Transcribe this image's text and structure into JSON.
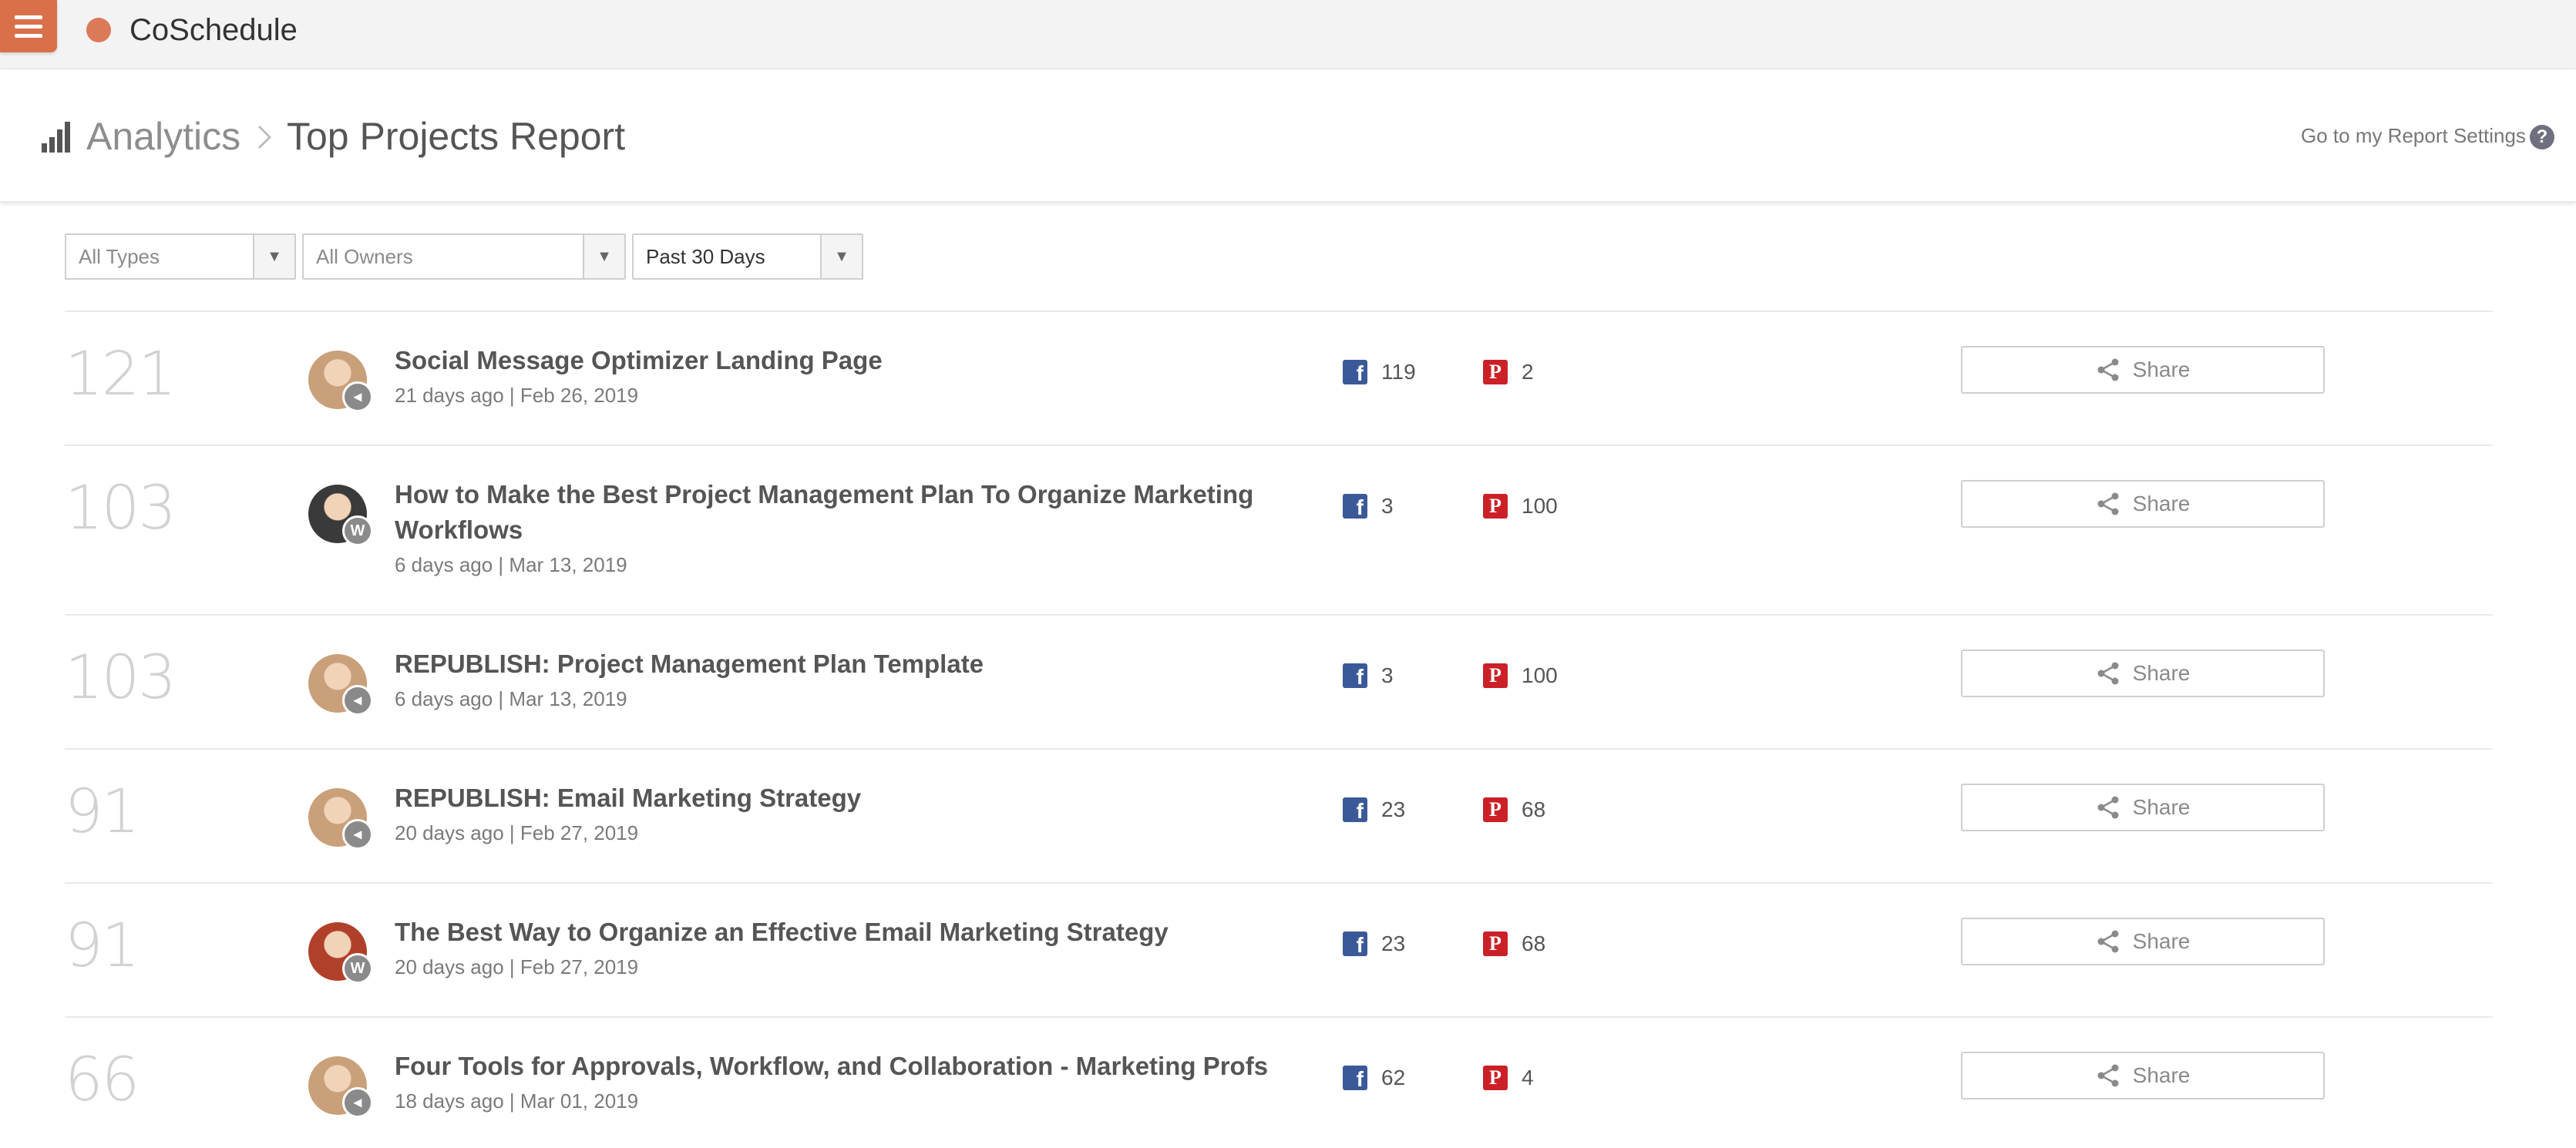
{
  "app": {
    "name": "CoSchedule",
    "accent": "#d9704a"
  },
  "header": {
    "breadcrumb_root": "Analytics",
    "page_title": "Top Projects Report",
    "settings_link": "Go to my Report Settings",
    "help_label": "?"
  },
  "filters": {
    "types": "All Types",
    "owners": "All Owners",
    "period": "Past 30 Days"
  },
  "share_label": "Share",
  "rows": [
    {
      "rank": "121",
      "title": "Social Message Optimizer Landing Page",
      "meta": "21 days ago | Feb 26, 2019",
      "facebook": "119",
      "pinterest": "2",
      "avatar_color": "#c9a07a",
      "badge": "megaphone"
    },
    {
      "rank": "103",
      "title": "How to Make the Best Project Management Plan To Organize Marketing Workflows",
      "meta": "6 days ago | Mar 13, 2019",
      "facebook": "3",
      "pinterest": "100",
      "avatar_color": "#3a3a3a",
      "badge": "wordpress"
    },
    {
      "rank": "103",
      "title": "REPUBLISH: Project Management Plan Template",
      "meta": "6 days ago | Mar 13, 2019",
      "facebook": "3",
      "pinterest": "100",
      "avatar_color": "#c9a07a",
      "badge": "megaphone"
    },
    {
      "rank": "91",
      "title": "REPUBLISH: Email Marketing Strategy",
      "meta": "20 days ago | Feb 27, 2019",
      "facebook": "23",
      "pinterest": "68",
      "avatar_color": "#c9a07a",
      "badge": "megaphone"
    },
    {
      "rank": "91",
      "title": "The Best Way to Organize an Effective Email Marketing Strategy",
      "meta": "20 days ago | Feb 27, 2019",
      "facebook": "23",
      "pinterest": "68",
      "avatar_color": "#b0402a",
      "badge": "wordpress"
    },
    {
      "rank": "66",
      "title": "Four Tools for Approvals, Workflow, and Collaboration - Marketing Profs",
      "meta": "18 days ago | Mar 01, 2019",
      "facebook": "62",
      "pinterest": "4",
      "avatar_color": "#c9a07a",
      "badge": "megaphone"
    }
  ]
}
